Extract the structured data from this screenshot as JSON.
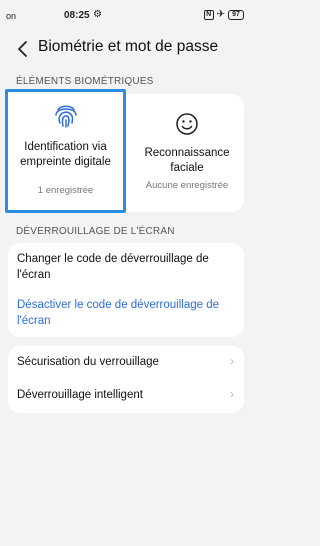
{
  "status_bar": {
    "left_text": "on",
    "time": "08:25",
    "nfc": "N",
    "battery": "97"
  },
  "header": {
    "title": "Biométrie et mot de passe"
  },
  "biometrics_section": {
    "label": "ÉLÉMENTS BIOMÉTRIQUES",
    "fingerprint": {
      "title": "Identification via empreinte digitale",
      "subtitle": "1 enregistrée"
    },
    "face": {
      "title": "Reconnaissance faciale",
      "subtitle": "Aucune enregistrée"
    }
  },
  "unlock_section": {
    "label": "DÉVERROUILLAGE DE L'ÉCRAN",
    "change_code": "Changer le code de déverrouillage de l'écran",
    "disable_code": "Désactiver le code de déverrouillage de l'écran"
  },
  "security_list": {
    "lock_security": "Sécurisation du verrouillage",
    "smart_unlock": "Déverrouillage intelligent"
  }
}
